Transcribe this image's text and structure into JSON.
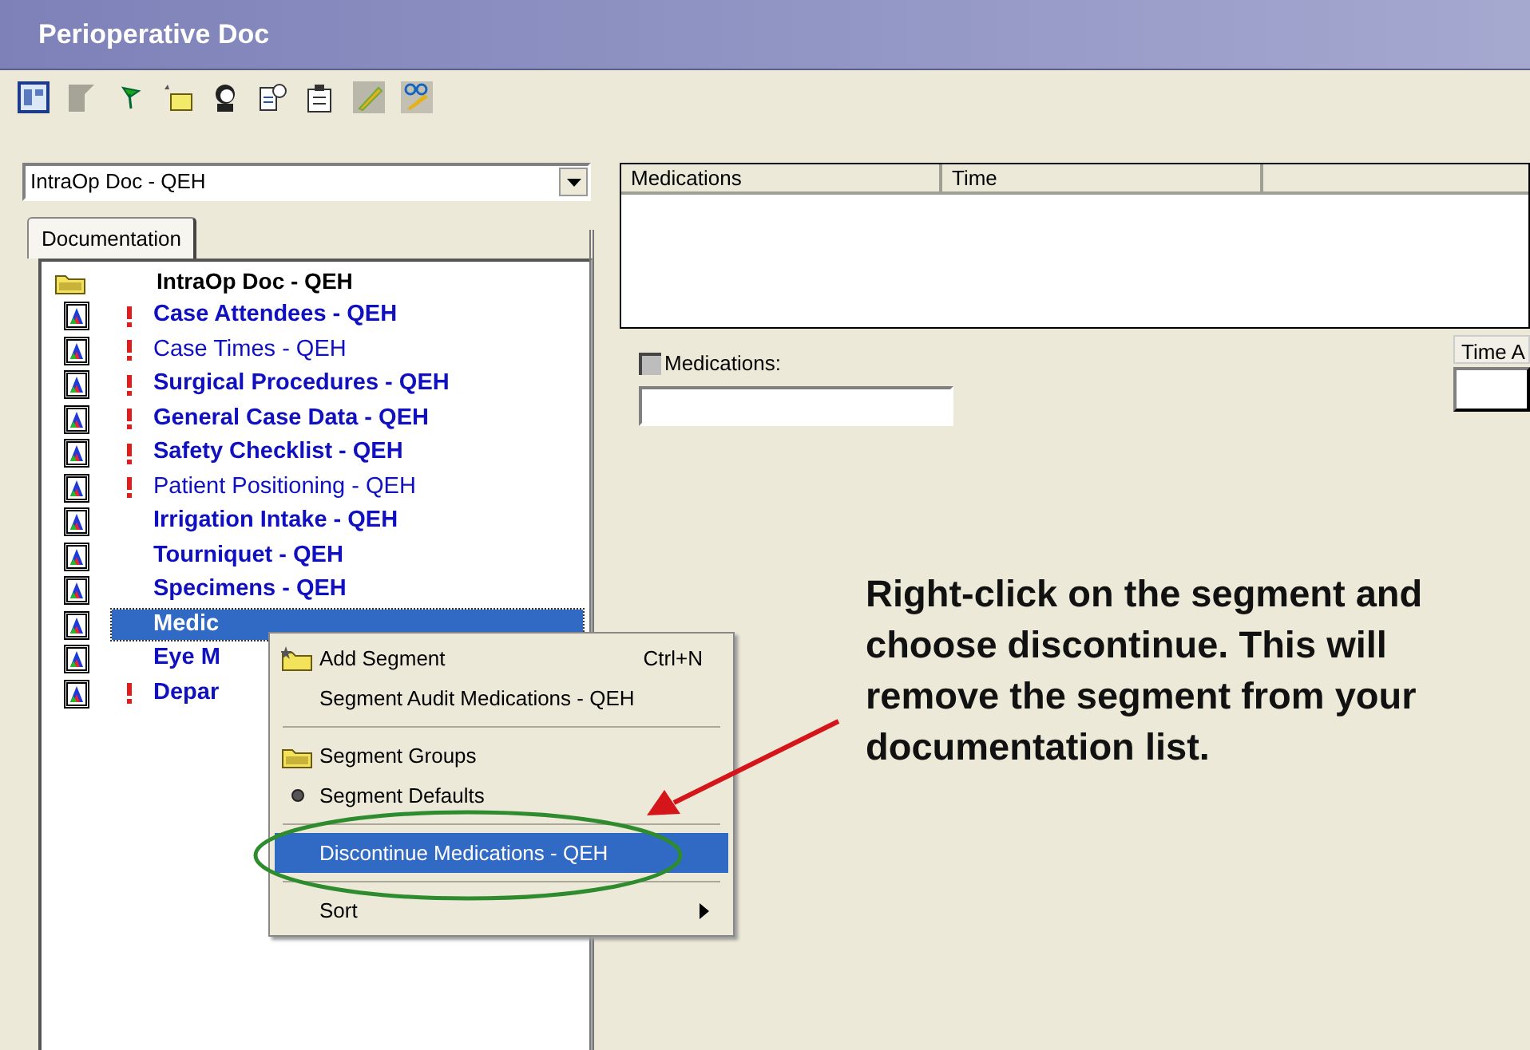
{
  "window": {
    "title": "Perioperative Doc"
  },
  "document_selector": {
    "value": "IntraOp Doc - QEH"
  },
  "tabs": [
    {
      "label": "Documentation",
      "selected": true
    }
  ],
  "tree": {
    "label": "IntraOp Doc - QEH",
    "children": [
      {
        "label": "Case Attendees - QEH",
        "bold": true,
        "flagged": true,
        "selected": false
      },
      {
        "label": "Case Times - QEH",
        "bold": false,
        "flagged": true,
        "selected": false
      },
      {
        "label": "Surgical Procedures - QEH",
        "bold": true,
        "flagged": true,
        "selected": false
      },
      {
        "label": "General Case Data - QEH",
        "bold": true,
        "flagged": true,
        "selected": false
      },
      {
        "label": "Safety Checklist - QEH",
        "bold": true,
        "flagged": true,
        "selected": false
      },
      {
        "label": "Patient Positioning - QEH",
        "bold": false,
        "flagged": true,
        "selected": false
      },
      {
        "label": "Irrigation Intake - QEH",
        "bold": true,
        "flagged": false,
        "selected": false
      },
      {
        "label": "Tourniquet - QEH",
        "bold": true,
        "flagged": false,
        "selected": false
      },
      {
        "label": "Specimens - QEH",
        "bold": true,
        "flagged": false,
        "selected": false
      },
      {
        "label": "Medic",
        "bold": true,
        "flagged": false,
        "selected": true
      },
      {
        "label": "Eye M",
        "bold": true,
        "flagged": false,
        "selected": false
      },
      {
        "label": "Depar",
        "bold": true,
        "flagged": true,
        "selected": false
      }
    ]
  },
  "table": {
    "columns": [
      "Medications",
      "Time"
    ]
  },
  "form": {
    "checkbox": {
      "label": "Medications:",
      "checked": false
    },
    "time_label": "Time A"
  },
  "context_menu": [
    {
      "kind": "item",
      "label": "Add Segment",
      "shortcut": "Ctrl+N",
      "selected": false
    },
    {
      "kind": "item",
      "label": "Segment Audit Medications - QEH",
      "selected": false
    },
    {
      "kind": "separator"
    },
    {
      "kind": "item",
      "label": "Segment Groups",
      "selected": false
    },
    {
      "kind": "item",
      "label": "Segment Defaults",
      "checked": true,
      "selected": false
    },
    {
      "kind": "separator"
    },
    {
      "kind": "item",
      "label": "Discontinue Medications - QEH",
      "selected": true
    },
    {
      "kind": "separator"
    },
    {
      "kind": "submenu",
      "label": "Sort",
      "selected": false
    }
  ],
  "annotation": {
    "text": "Right-click on the segment and choose discontinue. This will remove the segment from your documentation list."
  }
}
